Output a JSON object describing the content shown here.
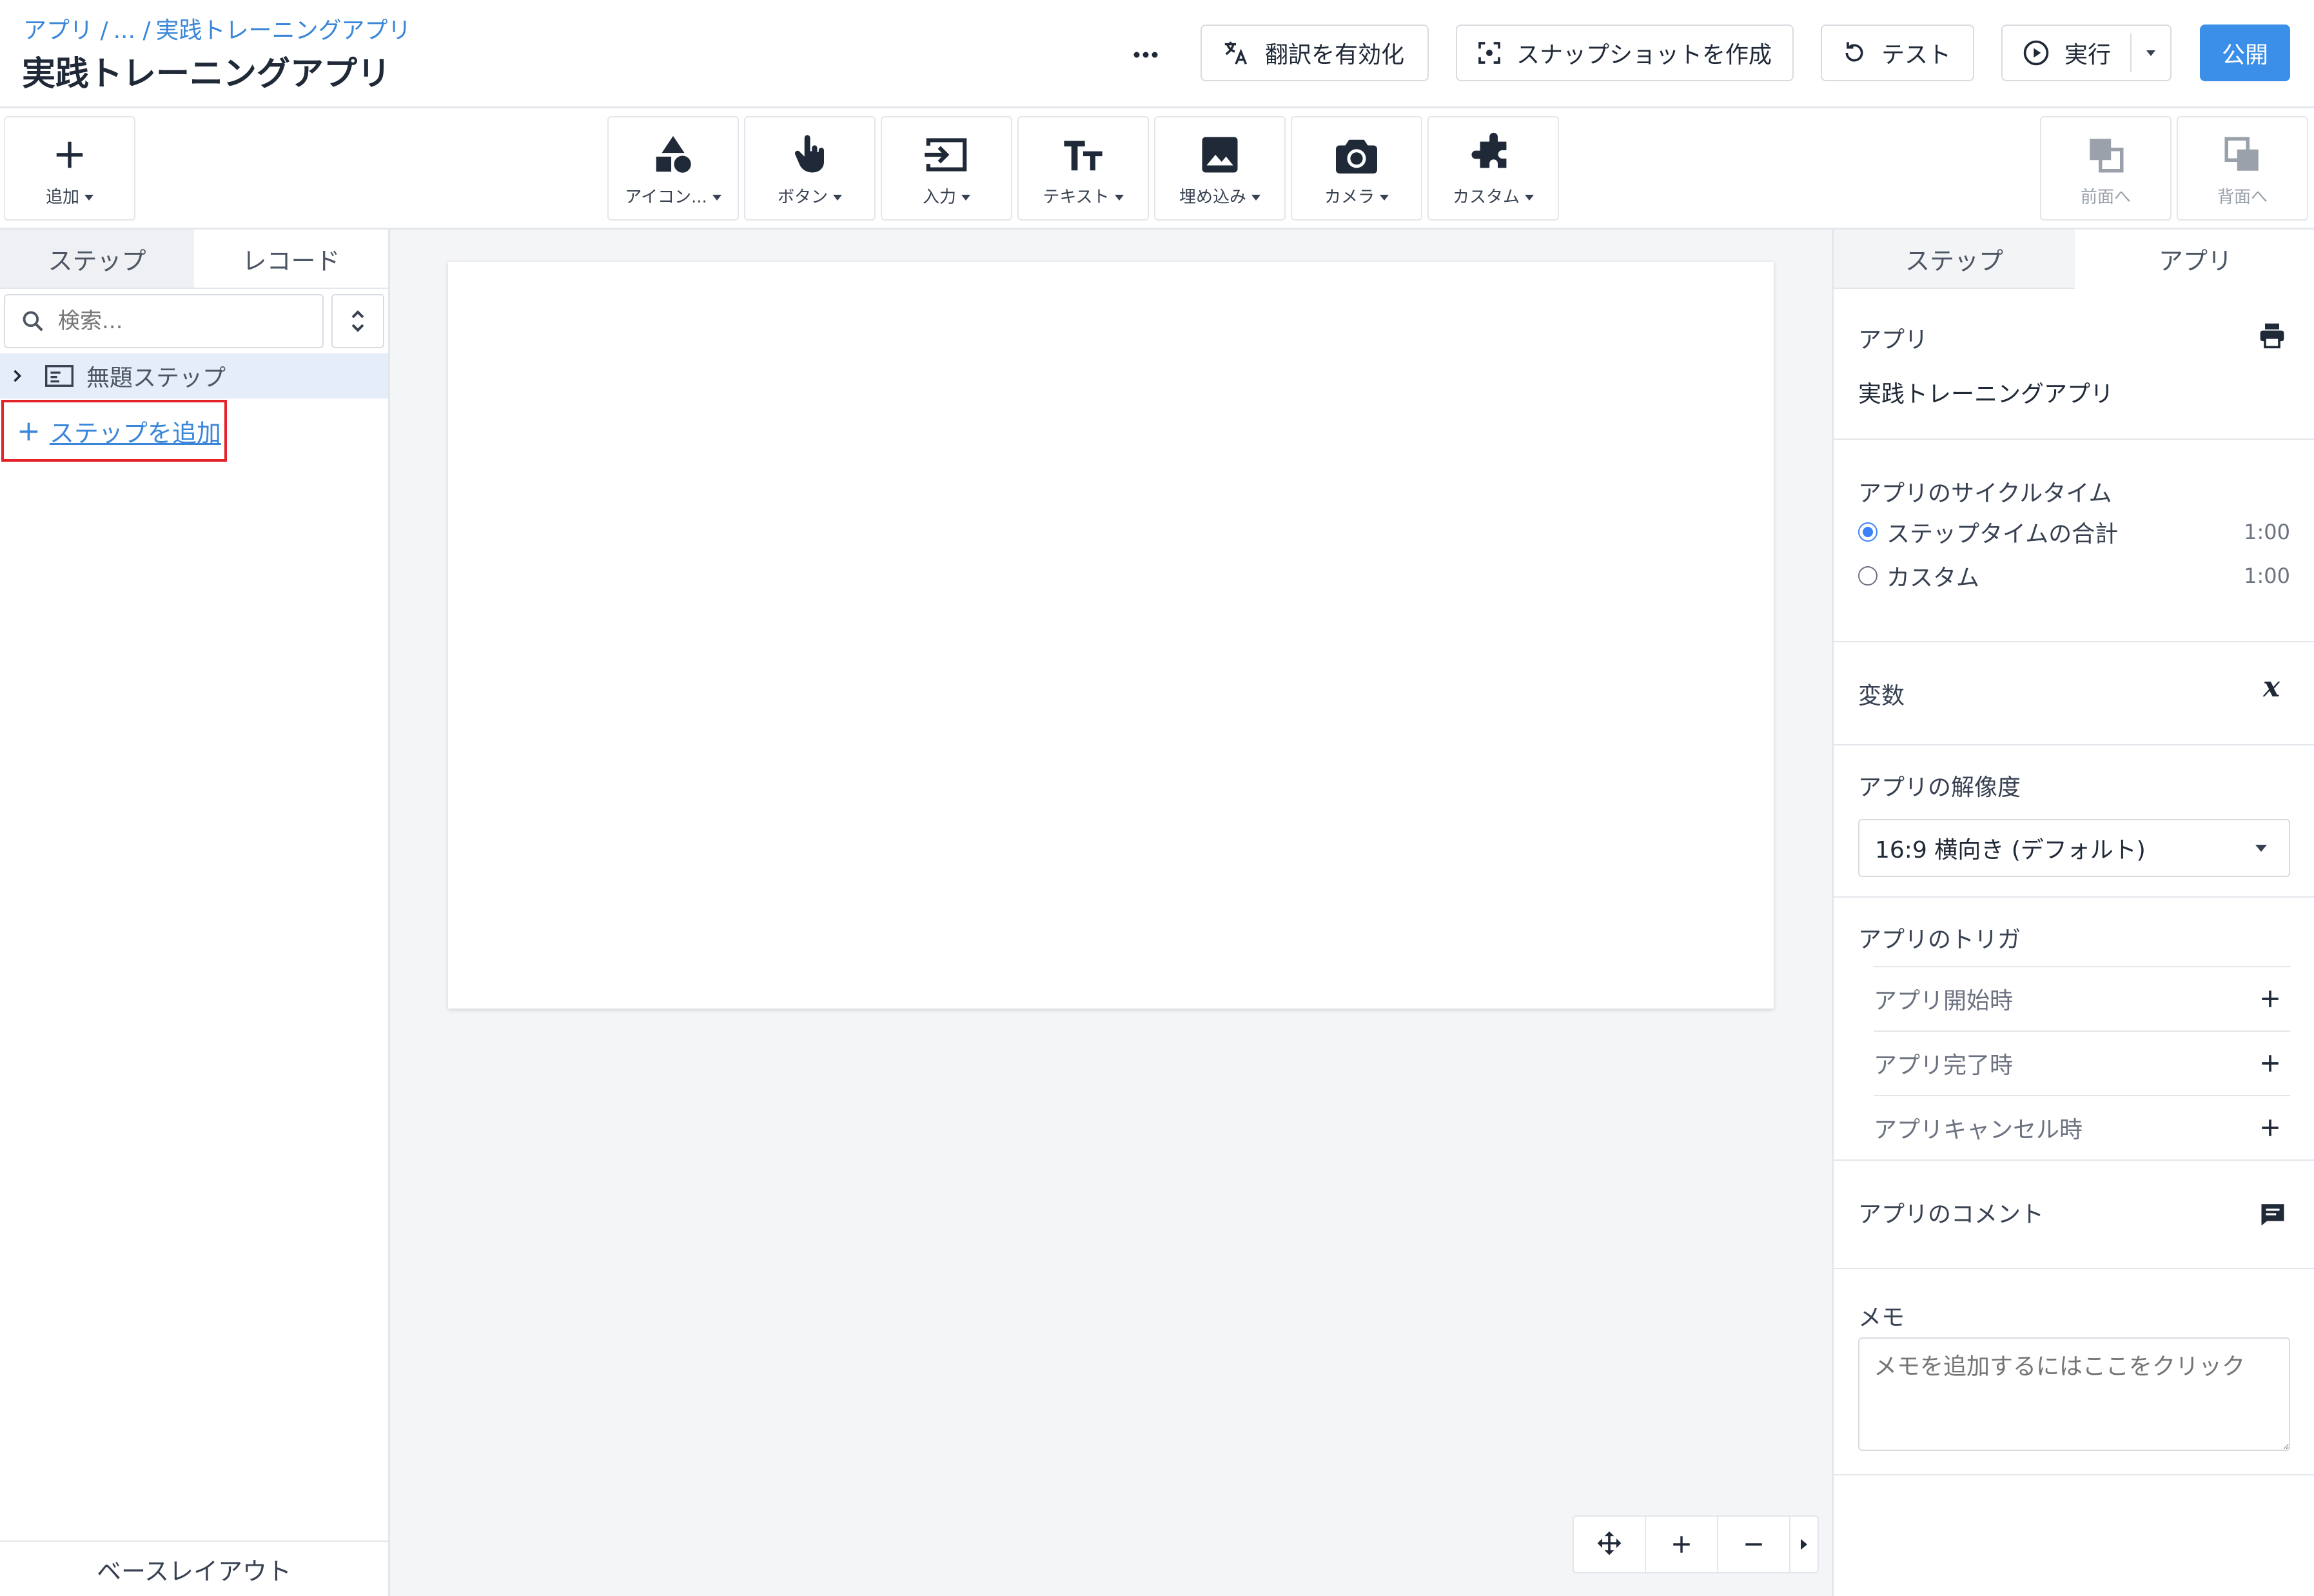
{
  "header": {
    "breadcrumb": [
      "アプリ /",
      "... /",
      "実践トレーニングアプリ"
    ],
    "title": "実践トレーニングアプリ",
    "more_label": "...",
    "translate_label": "翻訳を有効化",
    "snapshot_label": "スナップショットを作成",
    "test_label": "テスト",
    "run_label": "実行",
    "publish_label": "公開"
  },
  "toolbar": {
    "add_label": "追加",
    "tools": [
      "アイコン...",
      "ボタン",
      "入力",
      "テキスト",
      "埋め込み",
      "カメラ",
      "カスタム"
    ],
    "front_label": "前面へ",
    "back_label": "背面へ"
  },
  "left_panel": {
    "tabs": [
      "ステップ",
      "レコード"
    ],
    "search_placeholder": "検索...",
    "step_item": "無題ステップ",
    "add_step_label": "ステップを追加",
    "base_layout_label": "ベースレイアウト"
  },
  "right_panel": {
    "tabs": [
      "ステップ",
      "アプリ"
    ],
    "app_section_title": "アプリ",
    "app_name": "実践トレーニングアプリ",
    "cycle_title": "アプリのサイクルタイム",
    "cycle_options": [
      {
        "label": "ステップタイムの合計",
        "time": "1:00",
        "checked": true
      },
      {
        "label": "カスタム",
        "time": "1:00",
        "checked": false
      }
    ],
    "variables_title": "変数",
    "resolution_title": "アプリの解像度",
    "resolution_value": "16:9 横向き (デフォルト)",
    "triggers_title": "アプリのトリガ",
    "triggers": [
      "アプリ開始時",
      "アプリ完了時",
      "アプリキャンセル時"
    ],
    "comments_title": "アプリのコメント",
    "memo_title": "メモ",
    "memo_placeholder": "メモを追加するにはここをクリック"
  },
  "colors": {
    "primary": "#3b8fe8",
    "link": "#3a86d8",
    "highlight_border": "#e4222a",
    "selected_row": "#e4edf8"
  }
}
